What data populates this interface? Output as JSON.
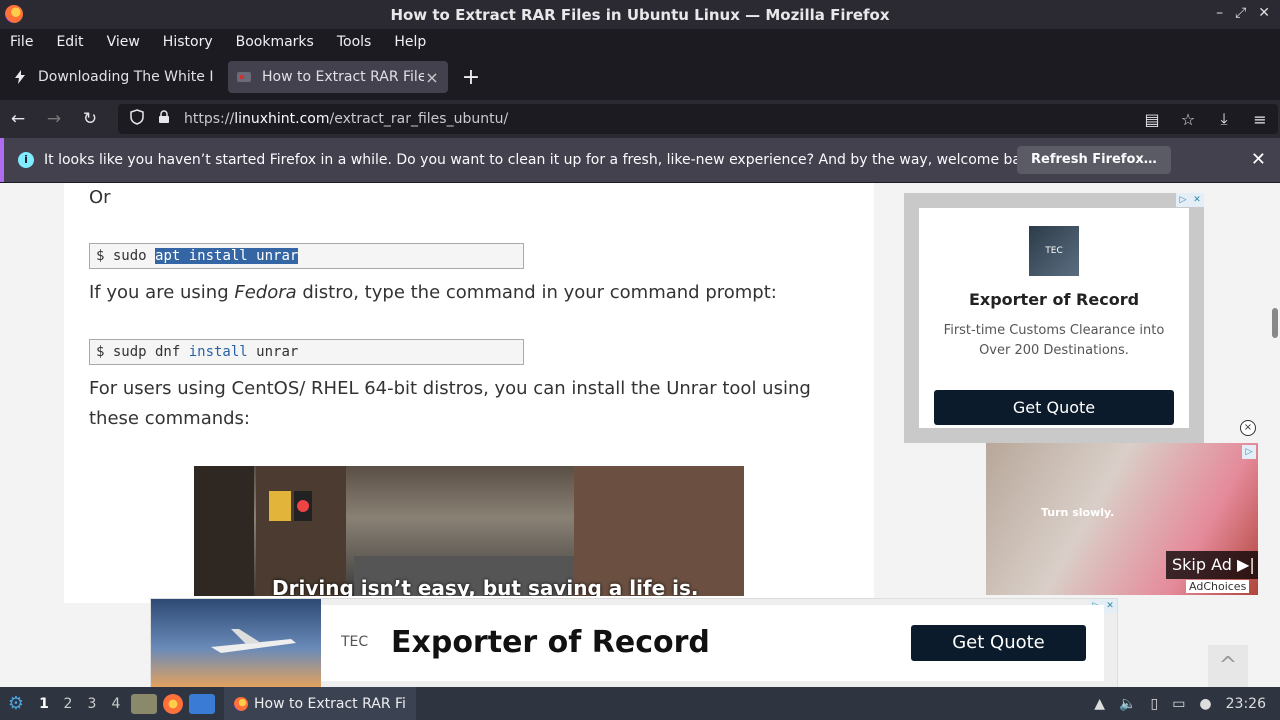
{
  "window": {
    "title": "How to Extract RAR Files in Ubuntu Linux — Mozilla Firefox",
    "controls": [
      "–",
      "⤢",
      "✕"
    ]
  },
  "menu": [
    "File",
    "Edit",
    "View",
    "History",
    "Bookmarks",
    "Tools",
    "Help"
  ],
  "tabs": [
    {
      "label": "Downloading The White I",
      "active": false
    },
    {
      "label": "How to Extract RAR Files",
      "active": true
    }
  ],
  "nav": {
    "url_prefix": "https://",
    "url_domain": "linuxhint.com",
    "url_path": "/extract_rar_files_ubuntu/"
  },
  "notification": {
    "text": "It looks like you haven’t started Firefox in a while. Do you want to clean it up for a fresh, like-new experience? And by the way, welcome back!",
    "button": "Refresh Firefox…"
  },
  "article": {
    "or": "Or",
    "cmd1_prefix": "$ sudo ",
    "cmd1_selected": "apt install unrar",
    "fedora_pre": "If you are using ",
    "fedora_em": "Fedora",
    "fedora_post": " distro, type the command in your command prompt:",
    "cmd2_a": "$ sudp dnf ",
    "cmd2_kw": "install",
    "cmd2_b": " unrar",
    "centos": "For users using CentOS/ RHEL 64-bit distros, you can install the Unrar tool using these commands:",
    "video_caption": "Driving isn’t easy, but saving a life is."
  },
  "ads": {
    "card_logo": "TEC",
    "card_title": "Exporter of Record",
    "card_desc": "First-time Customs Clearance into Over 200 Destinations.",
    "card_button": "Get Quote",
    "video_text": "Turn slowly.",
    "skip": "Skip Ad",
    "adchoices": "AdChoices",
    "banner_logo": "TEC",
    "banner_headline": "Exporter of Record",
    "banner_button": "Get Quote"
  },
  "taskbar": {
    "workspaces": [
      "1",
      "2",
      "3",
      "4"
    ],
    "task_label": "How to Extract RAR Fi…",
    "clock": "23:26"
  }
}
